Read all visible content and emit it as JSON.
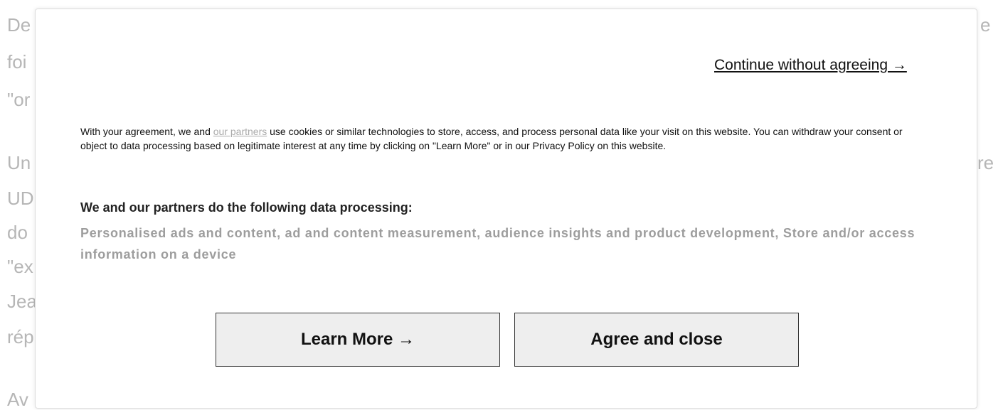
{
  "background": {
    "left_fragments": [
      "De",
      "foi",
      "\"or",
      "Un",
      "UD",
      "do",
      "\"ex",
      "Jea",
      "rép",
      "Av"
    ],
    "right_fragments": [
      "e",
      "re"
    ]
  },
  "modal": {
    "continue_link": "Continue without agreeing →",
    "consent": {
      "before_link": "With your agreement, we and ",
      "partners_link": "our partners",
      "after_link": " use cookies or similar technologies to store, access, and process personal data like your visit on this website. You can withdraw your consent or object to data processing based on legitimate interest at any time by clicking on \"Learn More\" or in our Privacy Policy on this website."
    },
    "processing_heading": "We and our partners do the following data processing:",
    "processing_list": "Personalised ads and content, ad and content measurement, audience insights and product development, Store and/or access information on a device",
    "learn_more_label": "Learn More →",
    "agree_label": "Agree and close"
  }
}
